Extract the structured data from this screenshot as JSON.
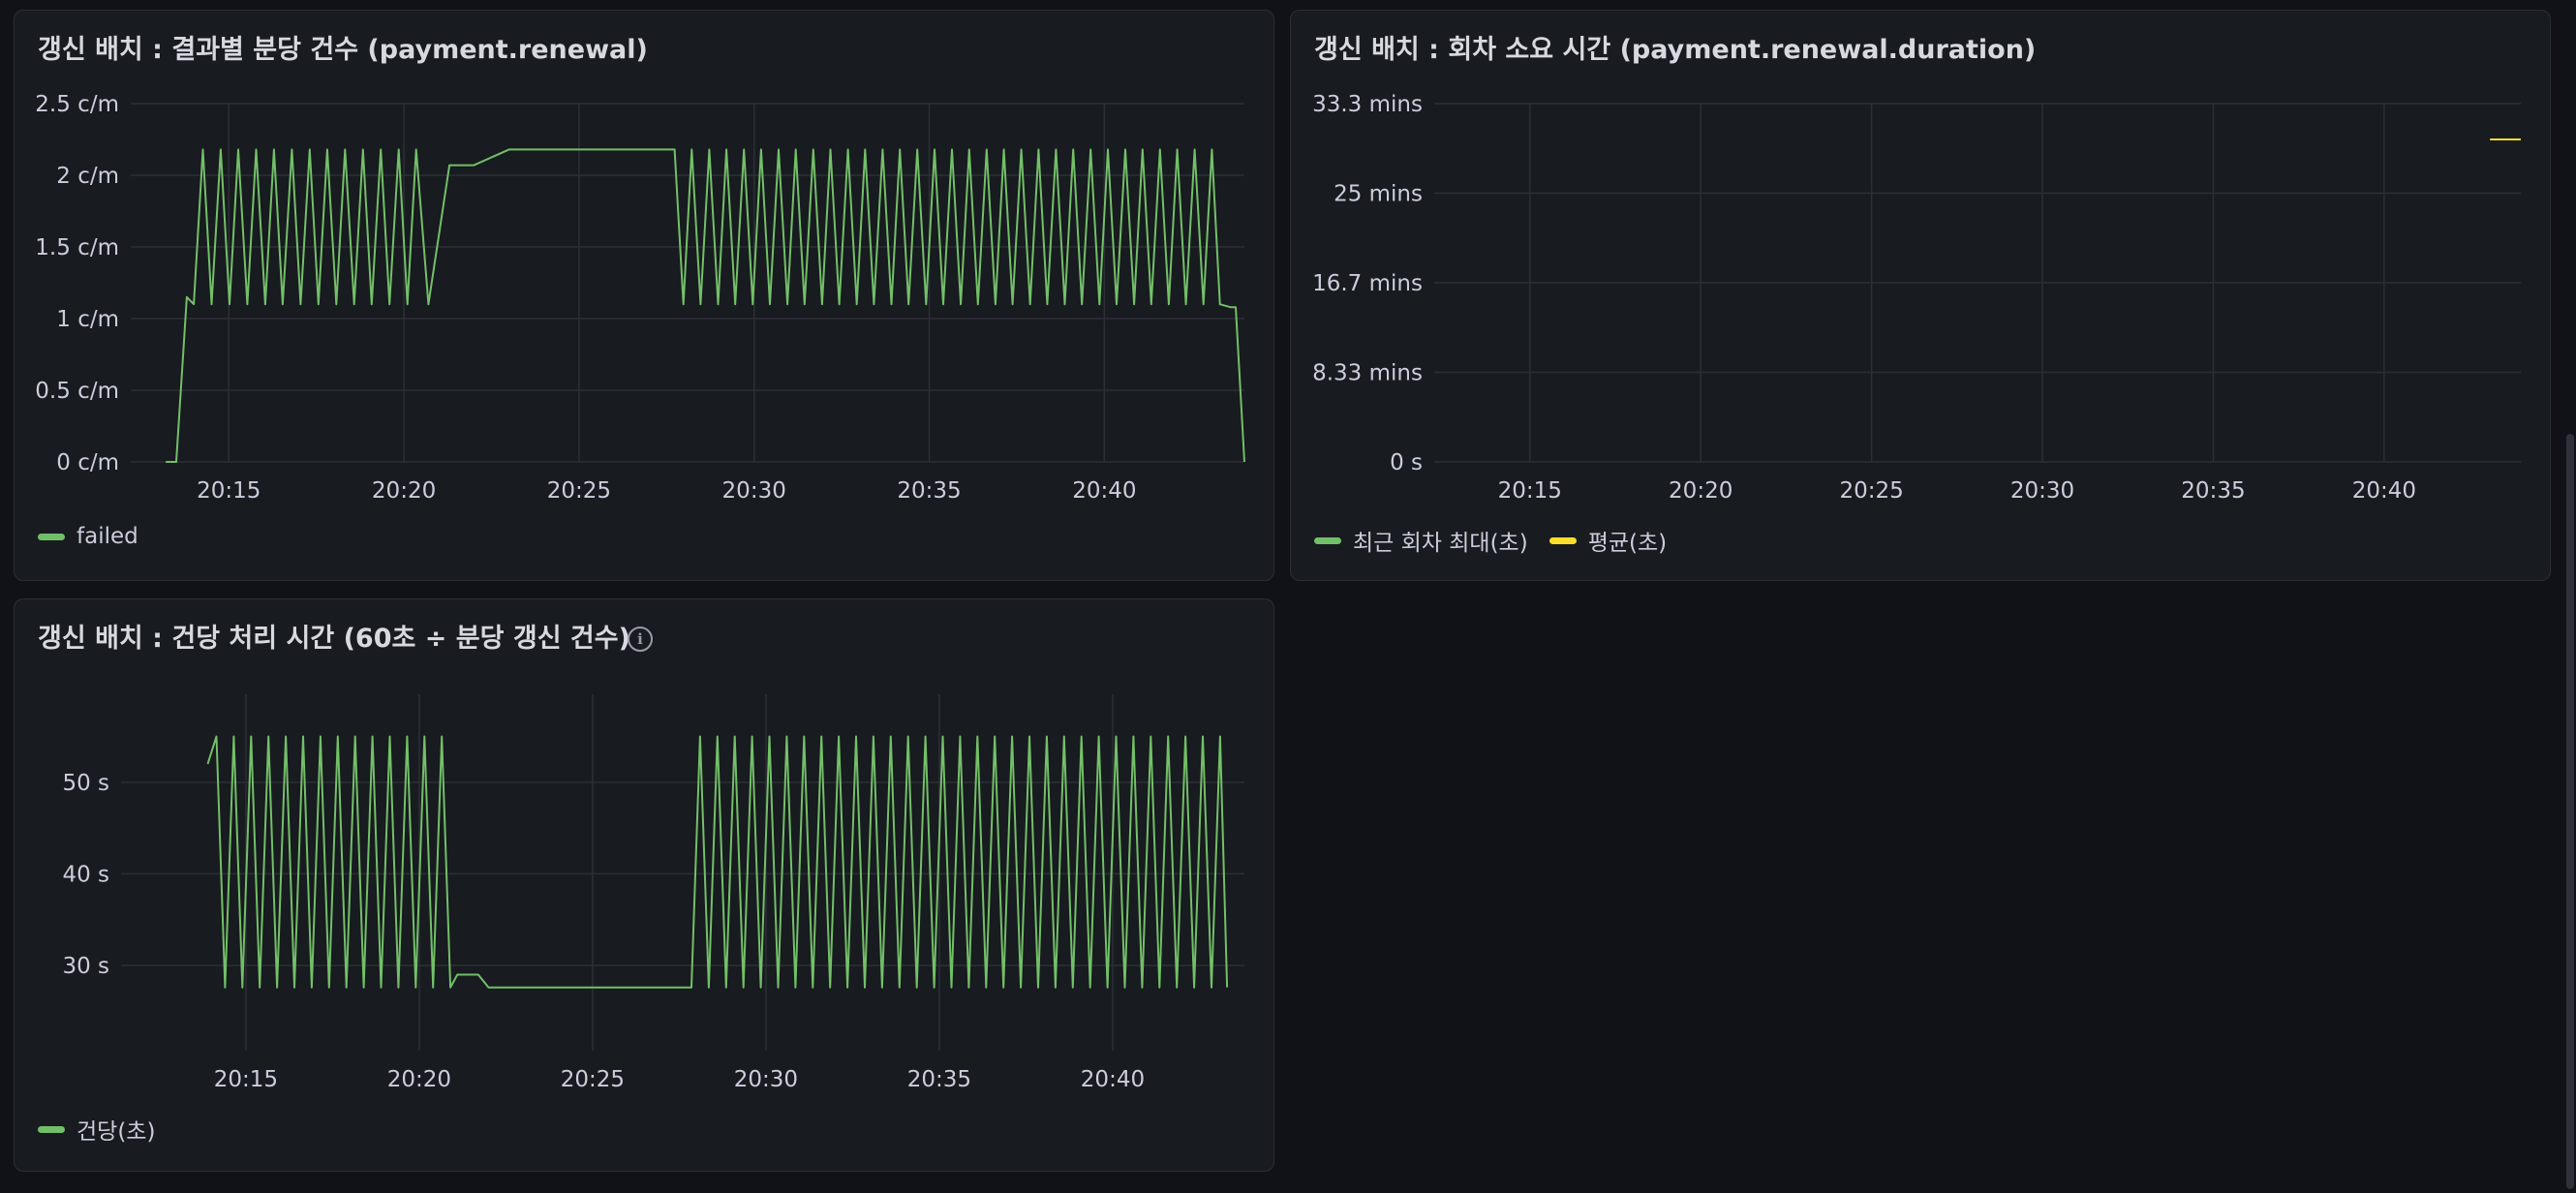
{
  "colors": {
    "green": "#73bf69",
    "yellow": "#fade2a",
    "grid": "#2c2f36"
  },
  "panels": [
    {
      "id": "p1",
      "title": "갱신 배치 : 결과별 분당 건수 (payment.renewal)",
      "info_icon": false,
      "legend": [
        {
          "label": "failed",
          "color": "#73bf69"
        }
      ],
      "chart_data": {
        "type": "line",
        "title": "갱신 배치 : 결과별 분당 건수 (payment.renewal)",
        "y_tick_labels": [
          "0 c/m",
          "0.5 c/m",
          "1 c/m",
          "1.5 c/m",
          "2 c/m",
          "2.5 c/m"
        ],
        "y_tick_values": [
          0,
          0.5,
          1,
          1.5,
          2,
          2.5
        ],
        "ylim": [
          0,
          2.5
        ],
        "x_tick_labels": [
          "20:15",
          "20:20",
          "20:25",
          "20:30",
          "20:35",
          "20:40"
        ],
        "x_tick_values": [
          915,
          920,
          925,
          930,
          935,
          940
        ],
        "xlim": [
          912.2,
          944.0
        ],
        "grid": true,
        "legend_position": "bottom-left",
        "series": [
          {
            "name": "failed",
            "color": "#73bf69",
            "x": [
              913.2,
              913.5,
              913.8,
              914.0,
              914.26,
              914.51,
              914.77,
              915.02,
              915.27,
              915.53,
              915.78,
              916.04,
              916.29,
              916.54,
              916.8,
              917.05,
              917.31,
              917.56,
              917.81,
              918.07,
              918.32,
              918.58,
              918.83,
              919.08,
              919.34,
              919.59,
              919.85,
              920.1,
              920.35,
              920.7,
              921.3,
              921.5,
              922.0,
              923.0,
              924.0,
              925.0,
              926.0,
              927.0,
              927.5,
              927.73,
              927.98,
              928.22,
              928.47,
              928.72,
              928.97,
              929.21,
              929.46,
              929.71,
              929.96,
              930.2,
              930.45,
              930.7,
              930.95,
              931.19,
              931.44,
              931.69,
              931.94,
              932.18,
              932.43,
              932.68,
              932.93,
              933.17,
              933.42,
              933.67,
              933.92,
              934.16,
              934.41,
              934.66,
              934.91,
              935.15,
              935.4,
              935.65,
              935.9,
              936.14,
              936.39,
              936.64,
              936.89,
              937.13,
              937.38,
              937.63,
              937.88,
              938.12,
              938.37,
              938.62,
              938.87,
              939.11,
              939.36,
              939.61,
              939.86,
              940.1,
              940.35,
              940.6,
              940.85,
              941.09,
              941.34,
              941.59,
              941.84,
              942.08,
              942.33,
              942.58,
              942.83,
              943.07,
              943.3,
              943.6,
              943.75,
              944.0
            ],
            "y": [
              0,
              0,
              1.15,
              1.1,
              2.18,
              1.1,
              2.18,
              1.1,
              2.18,
              1.1,
              2.18,
              1.1,
              2.18,
              1.1,
              2.18,
              1.1,
              2.18,
              1.1,
              2.18,
              1.1,
              2.18,
              1.1,
              2.18,
              1.1,
              2.18,
              1.1,
              2.18,
              1.1,
              2.18,
              1.1,
              2.07,
              2.07,
              2.07,
              2.18,
              2.18,
              2.18,
              2.18,
              2.18,
              2.18,
              2.18,
              1.1,
              2.18,
              1.1,
              2.18,
              1.1,
              2.18,
              1.1,
              2.18,
              1.1,
              2.18,
              1.1,
              2.18,
              1.1,
              2.18,
              1.1,
              2.18,
              1.1,
              2.18,
              1.1,
              2.18,
              1.1,
              2.18,
              1.1,
              2.18,
              1.1,
              2.18,
              1.1,
              2.18,
              1.1,
              2.18,
              1.1,
              2.18,
              1.1,
              2.18,
              1.1,
              2.18,
              1.1,
              2.18,
              1.1,
              2.18,
              1.1,
              2.18,
              1.1,
              2.18,
              1.1,
              2.18,
              1.1,
              2.18,
              1.1,
              2.18,
              1.1,
              2.18,
              1.1,
              2.18,
              1.1,
              2.18,
              1.1,
              2.18,
              1.1,
              2.18,
              1.1,
              2.18,
              1.1,
              1.08,
              1.08,
              0
            ]
          }
        ]
      }
    },
    {
      "id": "p2",
      "title": "갱신 배치 : 회차 소요 시간 (payment.renewal.duration)",
      "info_icon": false,
      "legend": [
        {
          "label": "최근 회차 최대(초)",
          "color": "#73bf69"
        },
        {
          "label": "평균(초)",
          "color": "#fade2a"
        }
      ],
      "chart_data": {
        "type": "line",
        "title": "갱신 배치 : 회차 소요 시간 (payment.renewal.duration)",
        "y_tick_labels": [
          "0 s",
          "8.33 mins",
          "16.7 mins",
          "25 mins",
          "33.3 mins"
        ],
        "y_tick_values": [
          0,
          500,
          1000,
          1500,
          2000
        ],
        "ylim": [
          0,
          2000
        ],
        "x_tick_labels": [
          "20:15",
          "20:20",
          "20:25",
          "20:30",
          "20:35",
          "20:40"
        ],
        "x_tick_values": [
          915,
          920,
          925,
          930,
          935,
          940
        ],
        "xlim": [
          912.2,
          944.0
        ],
        "grid": true,
        "legend_position": "bottom-left",
        "series": [
          {
            "name": "최근 회차 최대(초)",
            "color": "#73bf69",
            "x": [],
            "y": []
          },
          {
            "name": "평균(초)",
            "color": "#fade2a",
            "x": [
              943.1,
              944.0
            ],
            "y": [
              1800,
              1800
            ]
          }
        ]
      }
    },
    {
      "id": "p3",
      "title": "갱신 배치 : 건당 처리 시간 (60초 ÷ 분당 갱신 건수)",
      "info_icon": true,
      "legend": [
        {
          "label": "건당(초)",
          "color": "#73bf69"
        }
      ],
      "chart_data": {
        "type": "line",
        "title": "갱신 배치 : 건당 처리 시간 (60초 ÷ 분당 갱신 건수)",
        "y_tick_labels": [
          "30 s",
          "40 s",
          "50 s"
        ],
        "y_tick_values": [
          30,
          40,
          50
        ],
        "ylim": [
          20.7,
          59.6
        ],
        "x_tick_labels": [
          "20:15",
          "20:20",
          "20:25",
          "20:30",
          "20:35",
          "20:40"
        ],
        "x_tick_values": [
          915,
          920,
          925,
          930,
          935,
          940
        ],
        "xlim": [
          911.4,
          943.8
        ],
        "grid": true,
        "legend_position": "bottom-left",
        "series": [
          {
            "name": "건당(초)",
            "color": "#73bf69",
            "x": [
              913.9,
              914.15,
              914.4,
              914.65,
              914.9,
              915.15,
              915.4,
              915.65,
              915.9,
              916.15,
              916.4,
              916.65,
              916.9,
              917.15,
              917.4,
              917.65,
              917.9,
              918.15,
              918.4,
              918.65,
              918.9,
              919.15,
              919.4,
              919.65,
              919.9,
              920.15,
              920.4,
              920.65,
              920.9,
              921.1,
              921.7,
              922.0,
              923.0,
              924.0,
              925.0,
              926.0,
              927.0,
              927.6,
              927.85,
              928.1,
              928.35,
              928.6,
              928.85,
              929.1,
              929.35,
              929.6,
              929.85,
              930.1,
              930.35,
              930.6,
              930.85,
              931.1,
              931.35,
              931.6,
              931.85,
              932.1,
              932.35,
              932.6,
              932.85,
              933.1,
              933.35,
              933.6,
              933.85,
              934.1,
              934.35,
              934.6,
              934.85,
              935.1,
              935.35,
              935.6,
              935.85,
              936.1,
              936.35,
              936.6,
              936.85,
              937.1,
              937.35,
              937.6,
              937.85,
              938.1,
              938.35,
              938.6,
              938.85,
              939.1,
              939.35,
              939.6,
              939.85,
              940.1,
              940.35,
              940.6,
              940.85,
              941.1,
              941.35,
              941.6,
              941.85,
              942.1,
              942.35,
              942.6,
              942.85,
              943.1,
              943.3
            ],
            "y": [
              52,
              55,
              27.6,
              55,
              27.6,
              55,
              27.6,
              55,
              27.6,
              55,
              27.6,
              55,
              27.6,
              55,
              27.6,
              55,
              27.6,
              55,
              27.6,
              55,
              27.6,
              55,
              27.6,
              55,
              27.6,
              55,
              27.6,
              55,
              27.6,
              29,
              29,
              27.6,
              27.6,
              27.6,
              27.6,
              27.6,
              27.6,
              27.6,
              27.6,
              55,
              27.6,
              55,
              27.6,
              55,
              27.6,
              55,
              27.6,
              55,
              27.6,
              55,
              27.6,
              55,
              27.6,
              55,
              27.6,
              55,
              27.6,
              55,
              27.6,
              55,
              27.6,
              55,
              27.6,
              55,
              27.6,
              55,
              27.6,
              55,
              27.6,
              55,
              27.6,
              55,
              27.6,
              55,
              27.6,
              55,
              27.6,
              55,
              27.6,
              55,
              27.6,
              55,
              27.6,
              55,
              27.6,
              55,
              27.6,
              55,
              27.6,
              55,
              27.6,
              55,
              27.6,
              55,
              27.6,
              55,
              27.6,
              55,
              27.6,
              55,
              27.6,
              55,
              55
            ]
          }
        ]
      }
    }
  ]
}
